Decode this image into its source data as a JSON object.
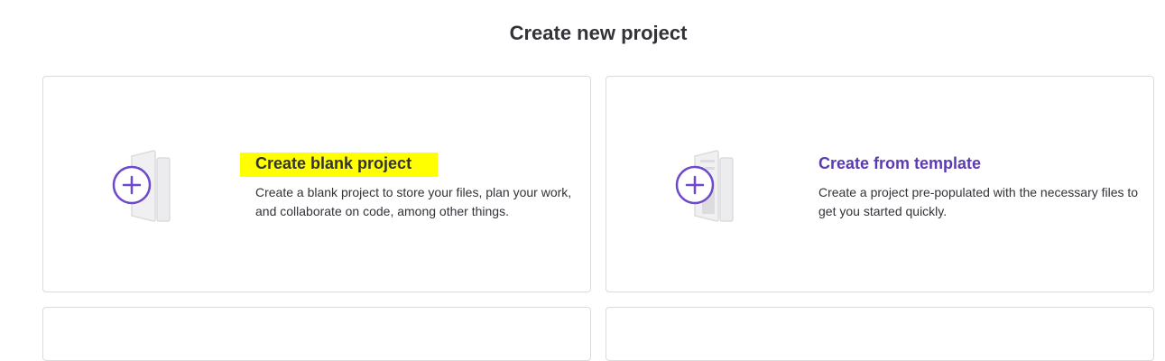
{
  "page": {
    "title": "Create new project"
  },
  "cards": [
    {
      "title": "Create blank project",
      "description": "Create a blank project to store your files, plan your work, and collaborate on code, among other things.",
      "icon": "blank-project-icon"
    },
    {
      "title": "Create from template",
      "description": "Create a project pre-populated with the necessary files to get you started quickly.",
      "icon": "template-project-icon"
    }
  ],
  "colors": {
    "accent": "#6e49cb",
    "highlight": "#ffff00",
    "border": "#dcdcde",
    "text": "#333238"
  }
}
